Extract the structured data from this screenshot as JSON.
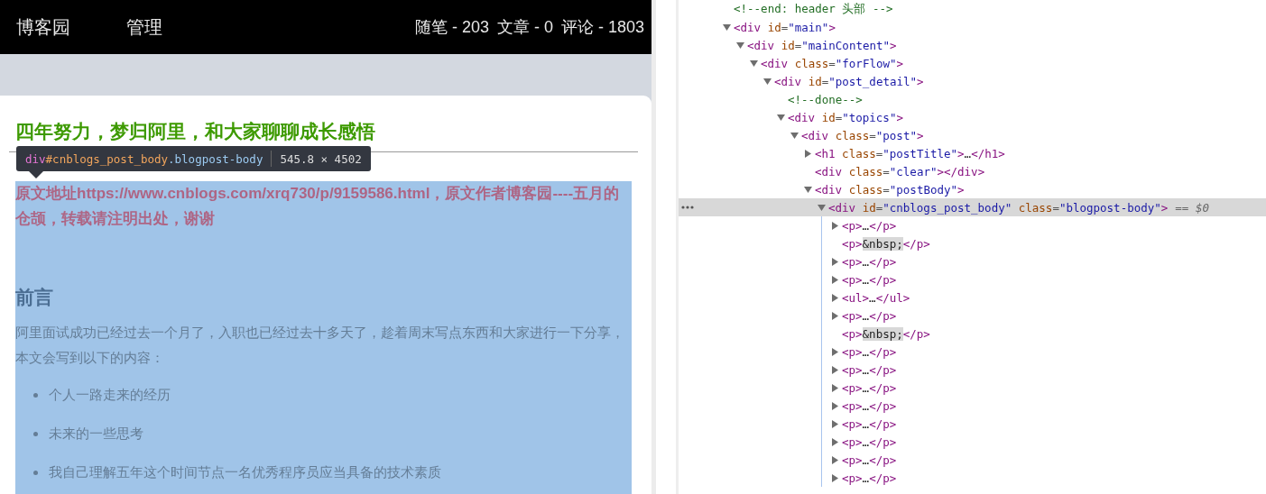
{
  "header": {
    "site": "博客园",
    "nav": "管理",
    "stats": [
      "随笔 - 203",
      "文章 - 0",
      "评论 - 1803"
    ]
  },
  "post": {
    "title": "四年努力，梦归阿里，和大家聊聊成长感悟",
    "source_note": "原文地址https://www.cnblogs.com/xrq730/p/9159586.html，原文作者博客园----五月的仓颉，转载请注明出处，谢谢",
    "heading": "前言",
    "intro": "阿里面试成功已经过去一个月了，入职也已经过去十多天了，趁着周末写点东西和大家进行一下分享，本文会写到以下的内容：",
    "bullets": [
      "个人一路走来的经历",
      "未来的一些思考",
      "我自己理解五年这个时间节点一名优秀程序员应当具备的技术素质"
    ]
  },
  "inspect_tooltip": {
    "tag": "div",
    "id": "#cnblogs_post_body",
    "class": ".blogpost-body",
    "size": "545.8 × 4502"
  },
  "elements_tree": {
    "nodes": [
      {
        "markup": "<!--end: header 头部 -->",
        "selected": false
      },
      {
        "markup": "<div id=\"main\">",
        "expanded": true,
        "selected": false,
        "children": [
          {
            "markup": "<div id=\"mainContent\">",
            "expanded": true,
            "selected": false,
            "children": [
              {
                "markup": "<div class=\"forFlow\">",
                "expanded": true,
                "selected": false,
                "children": [
                  {
                    "markup": "<div id=\"post_detail\">",
                    "expanded": true,
                    "selected": false,
                    "children": [
                      {
                        "markup": "<!--done-->",
                        "selected": false
                      },
                      {
                        "markup": "<div id=\"topics\">",
                        "expanded": true,
                        "selected": false,
                        "children": [
                          {
                            "markup": "<div class=\"post\">",
                            "expanded": true,
                            "selected": false,
                            "children": [
                              {
                                "markup": "<h1 class=\"postTitle\">…</h1>",
                                "expanded": false,
                                "selected": false
                              },
                              {
                                "markup": "<div class=\"clear\"></div>",
                                "selected": false
                              },
                              {
                                "markup": "<div class=\"postBody\">",
                                "expanded": true,
                                "selected": false,
                                "children": [
                                  {
                                    "markup": "<div id=\"cnblogs_post_body\" class=\"blogpost-body\">",
                                    "suffix": "== $0",
                                    "expanded": true,
                                    "selected": true,
                                    "children": [
                                      {
                                        "markup": "<p>…</p>",
                                        "expanded": false,
                                        "selected": false
                                      },
                                      {
                                        "markup": "<p>&nbsp;</p>",
                                        "selected": false
                                      },
                                      {
                                        "markup": "<p>…</p>",
                                        "expanded": false,
                                        "selected": false
                                      },
                                      {
                                        "markup": "<p>…</p>",
                                        "expanded": false,
                                        "selected": false
                                      },
                                      {
                                        "markup": "<ul>…</ul>",
                                        "expanded": false,
                                        "selected": false
                                      },
                                      {
                                        "markup": "<p>…</p>",
                                        "expanded": false,
                                        "selected": false
                                      },
                                      {
                                        "markup": "<p>&nbsp;</p>",
                                        "selected": false
                                      },
                                      {
                                        "markup": "<p>…</p>",
                                        "expanded": false,
                                        "selected": false
                                      },
                                      {
                                        "markup": "<p>…</p>",
                                        "expanded": false,
                                        "selected": false
                                      },
                                      {
                                        "markup": "<p>…</p>",
                                        "expanded": false,
                                        "selected": false
                                      },
                                      {
                                        "markup": "<p>…</p>",
                                        "expanded": false,
                                        "selected": false
                                      },
                                      {
                                        "markup": "<p>…</p>",
                                        "expanded": false,
                                        "selected": false
                                      },
                                      {
                                        "markup": "<p>…</p>",
                                        "expanded": false,
                                        "selected": false
                                      },
                                      {
                                        "markup": "<p>…</p>",
                                        "expanded": false,
                                        "selected": false
                                      },
                                      {
                                        "markup": "<p>…</p>",
                                        "expanded": false,
                                        "selected": false
                                      }
                                    ]
                                  }
                                ]
                              }
                            ]
                          }
                        ]
                      }
                    ]
                  }
                ]
              }
            ]
          }
        ]
      }
    ]
  }
}
